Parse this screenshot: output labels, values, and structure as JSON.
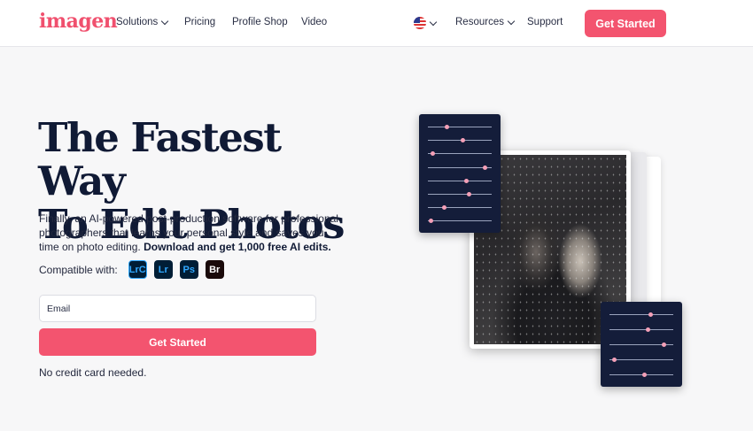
{
  "brand": {
    "logo_text": "imagen",
    "accent": "#f3546f",
    "navy": "#141d3a"
  },
  "nav": {
    "items": [
      {
        "label": "Solutions",
        "dropdown": true
      },
      {
        "label": "Pricing",
        "dropdown": false
      },
      {
        "label": "Profile Shop",
        "dropdown": false
      },
      {
        "label": "Video",
        "dropdown": false
      }
    ],
    "right_items": [
      {
        "label": "Resources",
        "dropdown": true
      },
      {
        "label": "Support",
        "dropdown": false
      }
    ],
    "language_icon": "us-flag-icon",
    "cta_label": "Get Started"
  },
  "hero": {
    "headline_line1": "The Fastest Way",
    "headline_line2": "To Edit Photos",
    "subtext": "Finally, an AI-powered post-production software for professional photographers that learns your personal style and saves you time on photo editing.",
    "subtext_bold": "Download and get 1,000 free AI edits.",
    "compatible_label": "Compatible with:",
    "apps": [
      "LrC",
      "Lr",
      "Ps",
      "Br"
    ],
    "email_placeholder": "Email",
    "cta_label": "Get Started",
    "note": "No credit card needed."
  },
  "sliders": {
    "top_panel_levels": [
      0.3,
      0.55,
      0.08,
      0.9,
      0.6,
      0.65,
      0.25,
      0.05
    ],
    "bottom_panel_levels": [
      0.65,
      0.6,
      0.85,
      0.08,
      0.55
    ]
  }
}
